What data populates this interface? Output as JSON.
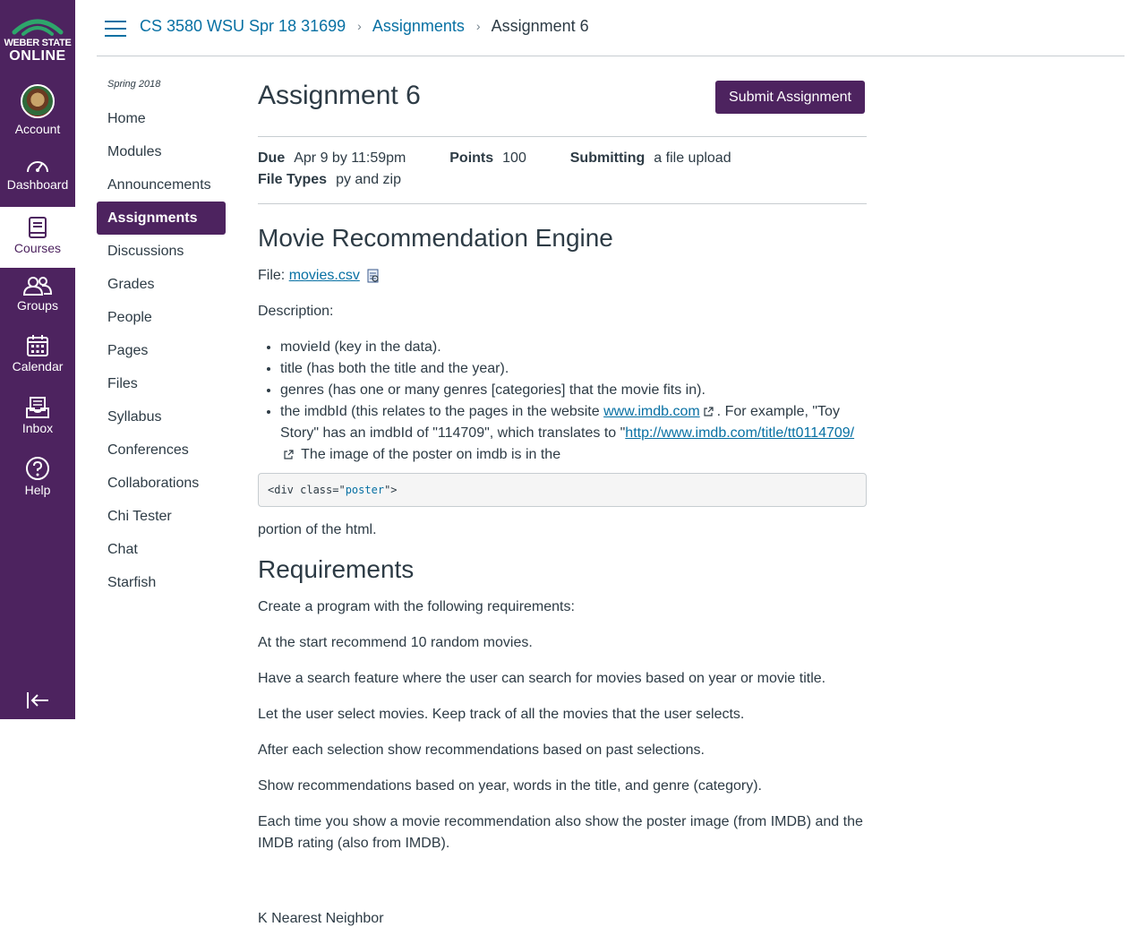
{
  "global_nav": {
    "logo": {
      "line1": "WEBER STATE",
      "line2": "ONLINE"
    },
    "items": [
      {
        "label": "Account",
        "icon": "avatar-icon"
      },
      {
        "label": "Dashboard",
        "icon": "dashboard-icon"
      },
      {
        "label": "Courses",
        "icon": "courses-icon"
      },
      {
        "label": "Groups",
        "icon": "groups-icon"
      },
      {
        "label": "Calendar",
        "icon": "calendar-icon"
      },
      {
        "label": "Inbox",
        "icon": "inbox-icon"
      },
      {
        "label": "Help",
        "icon": "help-icon"
      }
    ],
    "active": "Courses",
    "colors": {
      "nav_bg": "#4d235f",
      "link": "#0770a3",
      "active_text": "#4d235f"
    }
  },
  "breadcrumb": {
    "course": "CS 3580 WSU Spr 18 31699",
    "section": "Assignments",
    "current": "Assignment 6"
  },
  "course_nav": {
    "term": "Spring 2018",
    "items": [
      "Home",
      "Modules",
      "Announcements",
      "Assignments",
      "Discussions",
      "Grades",
      "People",
      "Pages",
      "Files",
      "Syllabus",
      "Conferences",
      "Collaborations",
      "Chi Tester",
      "Chat",
      "Starfish"
    ],
    "active": "Assignments"
  },
  "assignment": {
    "title": "Assignment 6",
    "submit_label": "Submit Assignment",
    "due_label": "Due",
    "due_value": "Apr 9 by 11:59pm",
    "points_label": "Points",
    "points_value": "100",
    "submitting_label": "Submitting",
    "submitting_value": "a file upload",
    "filetypes_label": "File Types",
    "filetypes_value": "py and zip"
  },
  "body": {
    "heading1": "Movie Recommendation Engine",
    "file_prefix": "File:",
    "file_link": "movies.csv",
    "description_label": "Description:",
    "bullets": [
      "movieId (key in the data).",
      "title (has both the title and the year).",
      "genres (has one or many genres [categories] that the movie fits in)."
    ],
    "imdb_bullet": {
      "pre": "the imdbId (this relates to the pages in the website ",
      "link1": "www.imdb.com",
      "mid": ". For example, \"Toy Story\" has an imdbId of \"114709\", which translates to \"",
      "link2": "http://www.imdb.com/title/tt0114709/",
      "post": " The image of the poster on imdb is in the"
    },
    "code": {
      "pre": "<div class=\"",
      "link": "poster",
      "post": "\">"
    },
    "after_code": "portion of the html.",
    "heading2": "Requirements",
    "requirements": [
      "Create a program with the following requirements:",
      "At the start recommend 10 random movies.",
      "Have a search feature where the user can search for movies based on year or movie title.",
      "Let the user select movies. Keep track of all the movies that the user selects.",
      "After each selection show recommendations based on past selections.",
      "Show recommendations based on year, words in the title, and genre (category).",
      "Each time you show a movie recommendation also show the poster image (from IMDB) and the IMDB rating (also from IMDB)."
    ],
    "footer_text": "K Nearest Neighbor"
  }
}
